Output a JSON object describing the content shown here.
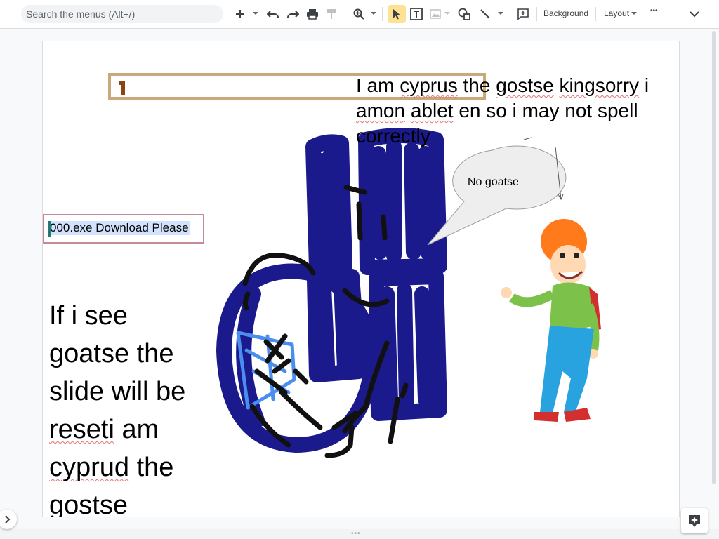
{
  "toolbar": {
    "search_placeholder": "Search the menus (Alt+/)",
    "background_label": "Background",
    "layout_label": "Layout",
    "more_label": "•••",
    "icons": [
      "plus-icon",
      "undo-icon",
      "redo-icon",
      "print-icon",
      "paint-format-icon",
      "zoom-icon",
      "select-icon",
      "text-box-icon",
      "image-icon",
      "shape-icon",
      "line-icon",
      "comment-icon",
      "collapse-icon"
    ]
  },
  "slide": {
    "top_text": "I am cyprus the gostse kingsorry i amon ablet en so i may not spell correctly",
    "exe_text": "000.exe Download Please",
    "left_text": "If i see goatse the slide will be reseti am cyprud the gostse",
    "bubble_text": "No goatse"
  },
  "colors": {
    "drawing_dark_blue": "#1a1a8c",
    "drawing_light_blue": "#4a8ff0",
    "drawing_black": "#111111",
    "select_highlight": "#fde293"
  }
}
